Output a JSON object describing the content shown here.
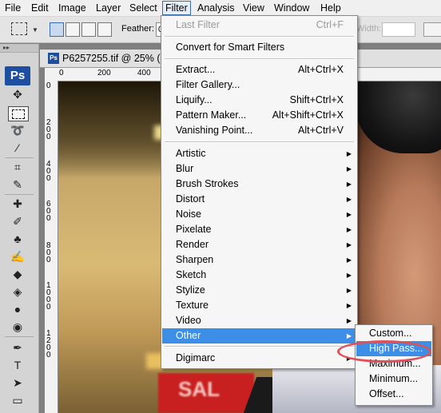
{
  "menubar": {
    "items": [
      "File",
      "Edit",
      "Image",
      "Layer",
      "Select",
      "Filter",
      "Analysis",
      "View",
      "Window",
      "Help"
    ]
  },
  "options": {
    "feather_label": "Feather:",
    "feather_value": "0",
    "width_label": "Width:"
  },
  "document": {
    "title": "P6257255.tif @ 25% (",
    "ruler_top": [
      "0",
      "200",
      "400"
    ],
    "ruler_left": [
      "0",
      "2\n0\n0",
      "4\n0\n0",
      "6\n0\n0",
      "8\n0\n0",
      "1\n0\n0\n0",
      "1\n2\n0\n0"
    ],
    "sign_text": "SAL"
  },
  "app_logo": "Ps",
  "filter_menu": {
    "last_filter": {
      "label": "Last Filter",
      "shortcut": "Ctrl+F"
    },
    "convert": "Convert for Smart Filters",
    "group1": [
      {
        "label": "Extract...",
        "shortcut": "Alt+Ctrl+X"
      },
      {
        "label": "Filter Gallery...",
        "shortcut": ""
      },
      {
        "label": "Liquify...",
        "shortcut": "Shift+Ctrl+X"
      },
      {
        "label": "Pattern Maker...",
        "shortcut": "Alt+Shift+Ctrl+X"
      },
      {
        "label": "Vanishing Point...",
        "shortcut": "Alt+Ctrl+V"
      }
    ],
    "submenus": [
      "Artistic",
      "Blur",
      "Brush Strokes",
      "Distort",
      "Noise",
      "Pixelate",
      "Render",
      "Sharpen",
      "Sketch",
      "Stylize",
      "Texture",
      "Video",
      "Other"
    ],
    "digimarc": "Digimarc"
  },
  "other_submenu": {
    "items": [
      "Custom...",
      "High Pass...",
      "Maximum...",
      "Minimum...",
      "Offset..."
    ],
    "highlighted": "High Pass..."
  },
  "colors": {
    "menu_highlight": "#3d8ee6",
    "annotation_ring": "#e0505a",
    "ps_blue": "#1d4ea0"
  }
}
